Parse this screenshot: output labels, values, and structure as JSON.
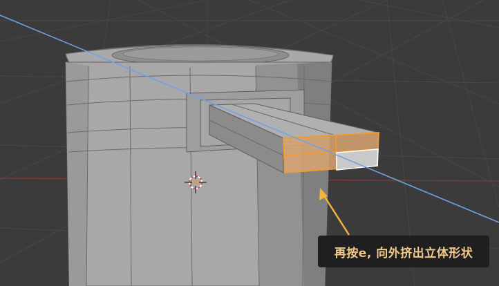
{
  "viewport": {
    "background_color": "#3b3b3b",
    "mesh_color": "#9a9a9a",
    "selection_color": "#f29a2e",
    "axis_line_color": "#6fa3e0"
  },
  "annotation": {
    "text": "再按e, 向外挤出立体形状",
    "text_color": "#f3c98a",
    "box_color": "#1f1f1f",
    "arrow_color": "#f0b53a"
  },
  "cursor": {
    "icon": "3d-cursor-icon"
  }
}
